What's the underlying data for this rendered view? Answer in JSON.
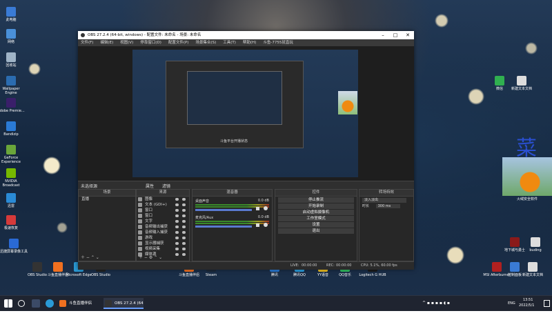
{
  "desktop": {
    "icons_left": [
      {
        "label": "此电脑",
        "color": "#3a7bd5"
      },
      {
        "label": "网络",
        "color": "#4a90d9"
      },
      {
        "label": "回收站",
        "color": "#9fb4c7"
      },
      {
        "label": "Wallpaper Engine",
        "color": "#2b6cb0"
      },
      {
        "label": "Adobe Premie...",
        "color": "#3a1f6a"
      },
      {
        "label": "Bandizip",
        "color": "#2a7ad5"
      },
      {
        "label": "GeForce Experience",
        "color": "#6aa63a"
      },
      {
        "label": "NVIDIA Broadcast",
        "color": "#76b900"
      },
      {
        "label": "迅雷",
        "color": "#2a8ad5"
      },
      {
        "label": "极速恢复",
        "color": "#d53a3a"
      }
    ],
    "icons_bottom": [
      {
        "label": "迅捷屏幕录像工具",
        "color": "#2a6ad5"
      },
      {
        "label": "OBS Studio",
        "color": "#333333"
      },
      {
        "label": "斗鱼直播伴侣",
        "color": "#f07020"
      },
      {
        "label": "Microsoft Edge",
        "color": "#2a9ad5"
      },
      {
        "label": "OBS Studio",
        "color": "#222222"
      },
      {
        "label": "斗鱼直播伴侣",
        "color": "#f07020"
      },
      {
        "label": "Steam",
        "color": "#1b2838"
      },
      {
        "label": "腾讯",
        "color": "#2a7ad5"
      },
      {
        "label": "腾讯QQ",
        "color": "#2aa0e0"
      },
      {
        "label": "YY语音",
        "color": "#f0c020"
      },
      {
        "label": "QQ音乐",
        "color": "#30c060"
      },
      {
        "label": "Logitech G HUB",
        "color": "#1a1a1a"
      },
      {
        "label": "MSI Afterburner",
        "color": "#b02020"
      }
    ],
    "icons_right": [
      {
        "label": "火绒安全软件",
        "color": "#e05030"
      },
      {
        "label": "微信",
        "color": "#30b050"
      },
      {
        "label": "新建文本文档",
        "color": "#dddddd"
      },
      {
        "label": "新建文本文档",
        "color": "#dddddd"
      },
      {
        "label": "地下城与勇士",
        "color": "#8a1a1a"
      },
      {
        "label": "buding",
        "color": "#dddddd"
      },
      {
        "label": "控制面板",
        "color": "#3a7bd5"
      }
    ],
    "wallpaper_char": "菜"
  },
  "obs": {
    "title": "OBS 27.2.4 (64-bit, windows) - 配置文件: 未命名 - 场景: 未命名",
    "menu": [
      "文件(F)",
      "编辑(E)",
      "视图(V)",
      "停靠窗口(D)",
      "配置文件(P)",
      "场景集合(S)",
      "工具(T)",
      "帮助(H)",
      "斗鱼-7755就直玩"
    ],
    "preview_caption": "斗鱼平台开播状态",
    "dock_tabs": [
      "未选择源",
      "属性",
      "滤镜"
    ],
    "scenes_header": "场景",
    "scenes": [
      "直播"
    ],
    "sources_header": "来源",
    "sources": [
      "图像",
      "文本 (GDI+)",
      "窗口",
      "窗口",
      "文字",
      "音频输出捕获",
      "音频输入捕获",
      "游戏",
      "显示器捕获",
      "视频采集",
      "媒体源"
    ],
    "mixer_header": "混音器",
    "mixer": [
      {
        "name": "桌面声音",
        "level": "0.0 dB"
      },
      {
        "name": "麦克风/Aux",
        "level": "0.0 dB"
      }
    ],
    "controls_header": "控件",
    "controls": [
      "停止推流",
      "开始录制",
      "启动虚拟摄像机",
      "工作室模式",
      "设置",
      "退出"
    ],
    "transitions_header": "转场特效",
    "transition_value": "淡入淡出",
    "duration_label": "时长",
    "duration_value": "300 ms",
    "status": {
      "live_label": "LIVE:",
      "live_time": "00:00:00",
      "rec_label": "REC:",
      "rec_time": "00:00:00",
      "cpu": "CPU: 5.1%, 60.00 fps"
    }
  },
  "taskbar": {
    "apps": [
      {
        "label": "斗鱼直播伴侣",
        "color": "#f07020"
      },
      {
        "label": "OBS 27.2.4 (64 bi...",
        "color": "#333333"
      }
    ],
    "tray": {
      "lang": "ENG",
      "time": "13:51",
      "date": "2022/5/1"
    }
  }
}
